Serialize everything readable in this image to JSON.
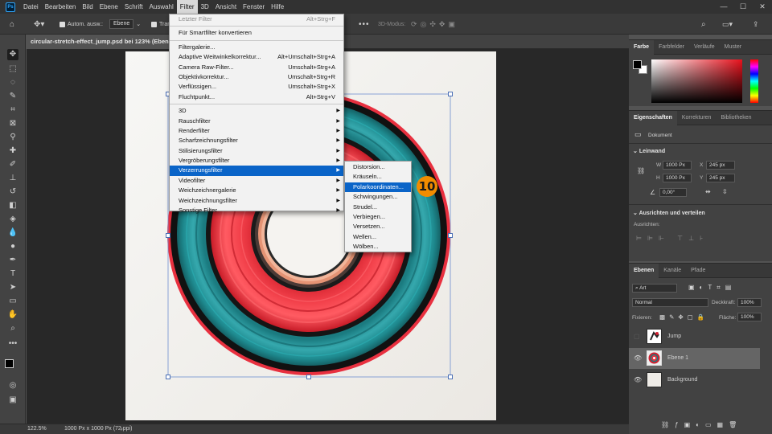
{
  "menubar": {
    "items": [
      "Datei",
      "Bearbeiten",
      "Bild",
      "Ebene",
      "Schrift",
      "Auswahl",
      "Filter",
      "3D",
      "Ansicht",
      "Fenster",
      "Hilfe"
    ],
    "active": "Filter"
  },
  "options": {
    "auto_select_label": "Autom. ausw.:",
    "auto_select_value": "Ebene",
    "transform_label": "Trans",
    "mode_3d": "3D-Modus:"
  },
  "document": {
    "tab_title": "circular-stretch-effect_jump.psd bei 123% (Ebene 1,"
  },
  "status": {
    "zoom": "122.5%",
    "size": "1000 Px x 1000 Px (72 ppi)"
  },
  "filter_menu": {
    "last_filter": "Letzter Filter",
    "last_filter_sc": "Alt+Strg+F",
    "smart": "Für Smartfilter konvertieren",
    "items_a": [
      {
        "label": "Filtergalerie...",
        "sc": ""
      },
      {
        "label": "Adaptive Weitwinkelkorrektur...",
        "sc": "Alt+Umschalt+Strg+A"
      },
      {
        "label": "Camera Raw-Filter...",
        "sc": "Umschalt+Strg+A"
      },
      {
        "label": "Objektivkorrektur...",
        "sc": "Umschalt+Strg+R"
      },
      {
        "label": "Verflüssigen...",
        "sc": "Umschalt+Strg+X"
      },
      {
        "label": "Fluchtpunkt...",
        "sc": "Alt+Strg+V"
      }
    ],
    "items_b": [
      "3D",
      "Rauschfilter",
      "Renderfilter",
      "Scharfzeichnungsfilter",
      "Stilisierungsfilter",
      "Vergröberungsfilter",
      "Verzerrungsfilter",
      "Videofilter",
      "Weichzeichnergalerie",
      "Weichzeichnungsfilter",
      "Sonstige Filter"
    ],
    "highlighted": "Verzerrungsfilter"
  },
  "submenu": {
    "items": [
      "Distorsion...",
      "Kräuseln...",
      "Polarkoordinaten...",
      "Schwingungen...",
      "Strudel...",
      "Verbiegen...",
      "Versetzen...",
      "Wellen...",
      "Wölben..."
    ],
    "highlighted": "Polarkoordinaten..."
  },
  "step_badge": "10",
  "color_panel": {
    "tabs": [
      "Farbe",
      "Farbfelder",
      "Verläufe",
      "Muster"
    ]
  },
  "properties": {
    "tabs": [
      "Eigenschaften",
      "Korrekturen",
      "Bibliotheken"
    ],
    "doc_label": "Dokument",
    "canvas_section": "Leinwand",
    "w_label": "W",
    "w_value": "1000 Px",
    "h_label": "H",
    "h_value": "1000 Px",
    "x_label": "X",
    "x_value": "245 px",
    "y_label": "Y",
    "y_value": "245 px",
    "angle_value": "0,00°",
    "align_section": "Ausrichten und verteilen",
    "align_label": "Ausrichten:"
  },
  "layers_panel": {
    "tabs": [
      "Ebenen",
      "Kanäle",
      "Pfade"
    ],
    "filter_value": "Art",
    "blend_mode": "Normal",
    "opacity_label": "Deckkraft:",
    "opacity_value": "100%",
    "lock_label": "Fixieren:",
    "fill_label": "Fläche:",
    "fill_value": "100%",
    "layers": [
      {
        "name": "Jump"
      },
      {
        "name": "Ebene 1"
      },
      {
        "name": "Background"
      }
    ]
  }
}
